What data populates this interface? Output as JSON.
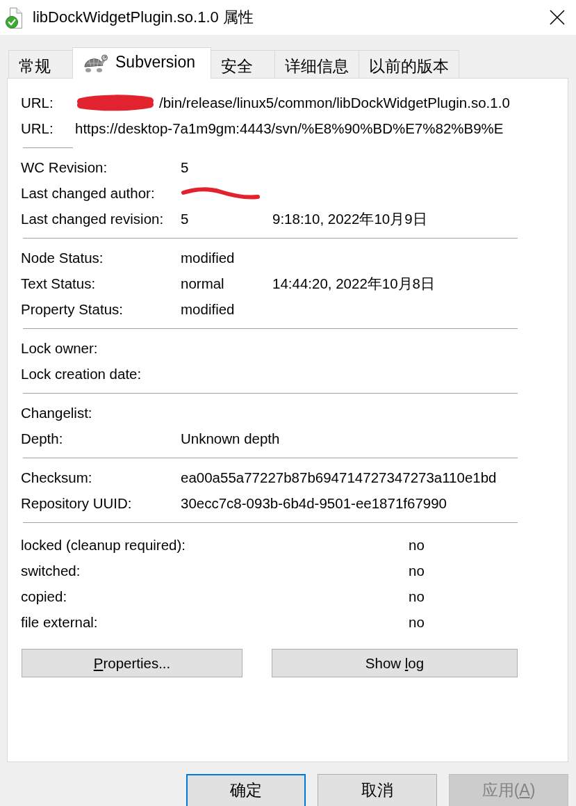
{
  "window": {
    "title": "libDockWidgetPlugin.so.1.0 属性"
  },
  "tabs": [
    {
      "label": "常规",
      "selected": false,
      "kind": "plain"
    },
    {
      "label": "Subversion",
      "selected": true,
      "kind": "icon"
    },
    {
      "label": "安全",
      "selected": false,
      "kind": "plain"
    },
    {
      "label": "详细信息",
      "selected": false,
      "kind": "plain"
    },
    {
      "label": "以前的版本",
      "selected": false,
      "kind": "plain"
    }
  ],
  "panel": {
    "sections": [
      {
        "kind": "url",
        "rows": [
          {
            "label": "URL:",
            "value": "/bin/release/linux5/common/libDockWidgetPlugin.so.1.0",
            "redacted": true
          },
          {
            "label": "URL:",
            "value": "https://desktop-7a1m9gm:4443/svn/%E8%90%BD%E7%82%B9%E",
            "redacted": false
          }
        ]
      },
      {
        "kind": "info",
        "rows": [
          {
            "label": "WC Revision:",
            "value": "5",
            "redacted": false
          },
          {
            "label": "Last changed author:",
            "redacted": true
          },
          {
            "label": "Last changed revision:",
            "value": "5",
            "date": "9:18:10, 2022年10月9日",
            "redacted": false
          }
        ]
      },
      {
        "kind": "info",
        "rows": [
          {
            "label": "Node Status:",
            "value": "modified",
            "redacted": false
          },
          {
            "label": "Text Status:",
            "value": "normal",
            "date": "14:44:20, 2022年10月8日",
            "redacted": false
          },
          {
            "label": "Property Status:",
            "value": "modified",
            "redacted": false
          }
        ]
      },
      {
        "kind": "info",
        "rows": [
          {
            "label": "Lock owner:",
            "redacted": false
          },
          {
            "label": "Lock creation date:",
            "redacted": false
          }
        ]
      },
      {
        "kind": "info",
        "rows": [
          {
            "label": "Changelist:",
            "redacted": false
          },
          {
            "label": "Depth:",
            "value": "Unknown depth",
            "redacted": false
          }
        ]
      },
      {
        "kind": "info",
        "rows": [
          {
            "label": "Checksum:",
            "value": "ea00a55a77227b87b694714727347273a110e1bd",
            "redacted": false
          },
          {
            "label": "Repository UUID:",
            "value": "30ecc7c8-093b-6b4d-9501-ee1871f67990",
            "redacted": false
          }
        ]
      },
      {
        "kind": "flags",
        "rows": [
          {
            "label": "locked (cleanup required):",
            "value": "no",
            "redacted": false
          },
          {
            "label": "switched:",
            "value": "no",
            "redacted": false
          },
          {
            "label": "copied:",
            "value": "no",
            "redacted": false
          },
          {
            "label": "file external:",
            "value": "no",
            "redacted": false
          }
        ]
      }
    ],
    "actions": [
      {
        "label_parts": [
          {
            "text": "P",
            "underline": true
          },
          {
            "text": "roperties...",
            "underline": false
          }
        ]
      },
      {
        "label_parts": [
          {
            "text": "Show ",
            "underline": false
          },
          {
            "text": "l",
            "underline": true
          },
          {
            "text": "og",
            "underline": false
          }
        ]
      }
    ]
  },
  "dialog_buttons": [
    {
      "label_parts": [
        {
          "text": "确定",
          "underline": false
        }
      ],
      "focused": true,
      "disabled": false
    },
    {
      "label_parts": [
        {
          "text": "取消",
          "underline": false
        }
      ],
      "focused": false,
      "disabled": false
    },
    {
      "label_parts": [
        {
          "text": "应用(",
          "underline": false
        },
        {
          "text": "A",
          "underline": true
        },
        {
          "text": ")",
          "underline": false
        }
      ],
      "focused": false,
      "disabled": true
    }
  ]
}
